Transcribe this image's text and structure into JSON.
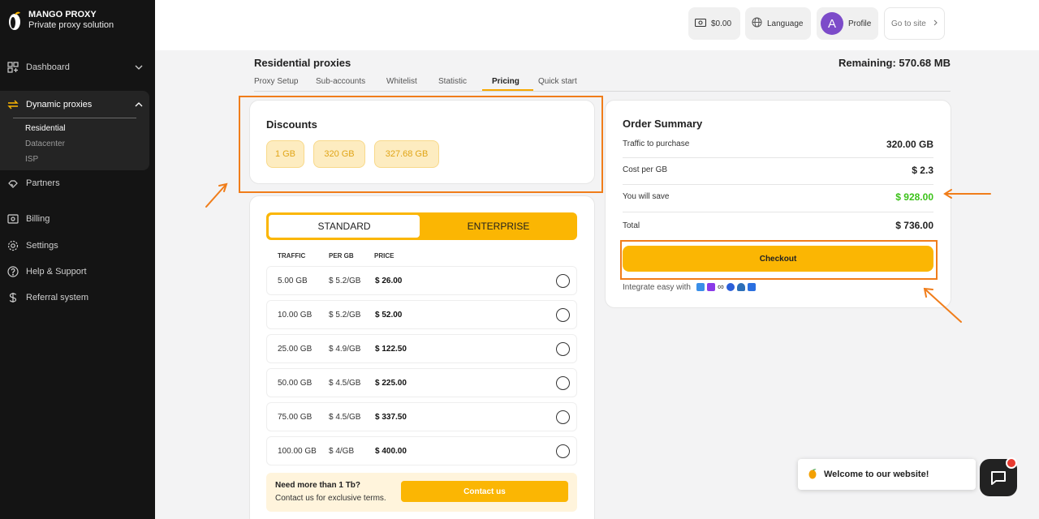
{
  "brand": {
    "name": "MANGO PROXY",
    "tagline": "Private proxy solution"
  },
  "sidebar": {
    "dashboard": "Dashboard",
    "dynamic_proxies": "Dynamic proxies",
    "sub_items": [
      "Residential",
      "Datacenter",
      "ISP"
    ],
    "partners": "Partners",
    "billing": "Billing",
    "settings": "Settings",
    "help": "Help & Support",
    "referral": "Referral system"
  },
  "header": {
    "balance": "$0.00",
    "language": "Language",
    "avatar_letter": "A",
    "profile": "Profile",
    "go_to_site": "Go to site"
  },
  "page": {
    "title": "Residential proxies",
    "remaining": "Remaining: 570.68 MB"
  },
  "tabs": [
    "Proxy Setup",
    "Sub-accounts",
    "Whitelist",
    "Statistic",
    "Pricing",
    "Quick start"
  ],
  "discounts": {
    "title": "Discounts",
    "chips": [
      "1 GB",
      "320 GB",
      "327.68 GB"
    ]
  },
  "plans": {
    "standard": "STANDARD",
    "enterprise": "ENTERPRISE"
  },
  "table": {
    "headers": [
      "TRAFFIC",
      "PER GB",
      "PRICE"
    ],
    "rows": [
      {
        "traffic": "5.00 GB",
        "per_gb": "$ 5.2/GB",
        "price": "$ 26.00"
      },
      {
        "traffic": "10.00 GB",
        "per_gb": "$ 5.2/GB",
        "price": "$ 52.00"
      },
      {
        "traffic": "25.00 GB",
        "per_gb": "$ 4.9/GB",
        "price": "$ 122.50"
      },
      {
        "traffic": "50.00 GB",
        "per_gb": "$ 4.5/GB",
        "price": "$ 225.00"
      },
      {
        "traffic": "75.00 GB",
        "per_gb": "$ 4.5/GB",
        "price": "$ 337.50"
      },
      {
        "traffic": "100.00 GB",
        "per_gb": "$ 4/GB",
        "price": "$ 400.00"
      }
    ]
  },
  "more": {
    "title": "Need more than 1 Tb?",
    "subtitle": "Contact us for exclusive terms.",
    "button": "Contact us"
  },
  "order": {
    "title": "Order Summary",
    "traffic_label": "Traffic to purchase",
    "traffic_value": "320.00 GB",
    "cost_label": "Cost per GB",
    "cost_value": "$ 2.3",
    "save_label": "You will save",
    "save_value": "$ 928.00",
    "total_label": "Total",
    "total_value": "$ 736.00",
    "checkout": "Checkout",
    "integrate": "Integrate easy with"
  },
  "chat": {
    "welcome": "Welcome to our website!"
  },
  "colors": {
    "accent": "#fbb603",
    "highlight": "#f07d1a",
    "save_green": "#3cc21a",
    "sidebar": "#141414"
  }
}
